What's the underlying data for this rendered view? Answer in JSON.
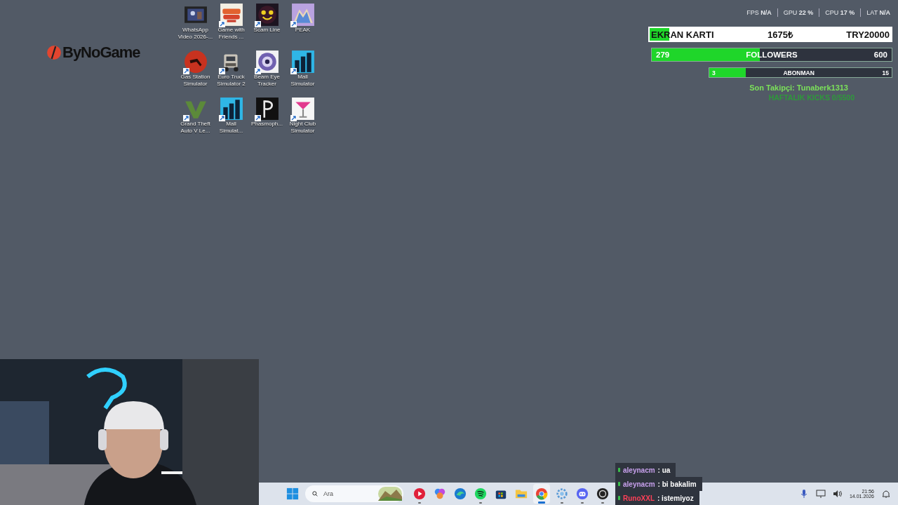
{
  "logo": {
    "text": "ByNoGame"
  },
  "desktop_icons": [
    {
      "kind": "video",
      "label": "WhatsApp Video 2026-...",
      "shortcut": false
    },
    {
      "kind": "game",
      "label": "Game with Friends ...",
      "shortcut": true
    },
    {
      "kind": "scam",
      "label": "Scam Line",
      "shortcut": true
    },
    {
      "kind": "peak",
      "label": "PEAK",
      "shortcut": true
    },
    {
      "kind": "gas",
      "label": "Gas Station Simulator",
      "shortcut": true
    },
    {
      "kind": "truck",
      "label": "Euro Truck Simulator 2",
      "shortcut": true
    },
    {
      "kind": "beam",
      "label": "Beam Eye Tracker",
      "shortcut": true
    },
    {
      "kind": "mall",
      "label": "Mall Simulator",
      "shortcut": true
    },
    {
      "kind": "gta",
      "label": "Grand Theft Auto V Le...",
      "shortcut": true
    },
    {
      "kind": "mall",
      "label": "Mall Simulat...",
      "shortcut": true
    },
    {
      "kind": "phasmo",
      "label": "Phasmoph...",
      "shortcut": true
    },
    {
      "kind": "club",
      "label": "Night Club Simulator",
      "shortcut": true
    }
  ],
  "stats": [
    {
      "label": "FPS",
      "value": "N/A"
    },
    {
      "label": "GPU",
      "value": "22 %"
    },
    {
      "label": "CPU",
      "value": "17 %"
    },
    {
      "label": "LAT",
      "value": "N/A"
    }
  ],
  "goals": [
    {
      "kind": "card",
      "title": "EKRAN KARTI",
      "current": "1675₺",
      "target": "TRY20000",
      "level": 0.08
    },
    {
      "kind": "followers",
      "title": "FOLLOWERS",
      "current": "279",
      "target": "600",
      "level": 0.45
    },
    {
      "kind": "subs",
      "title": "ABONMAN",
      "current": "3",
      "target": "15",
      "level": 0.2
    }
  ],
  "last_follower": "Son Takipçi: Tunaberk1313",
  "weekly_goal": "HAFTALIK KICKS 0/5500",
  "chat": [
    {
      "user": "aleynacm",
      "message": ": ua",
      "color": "#c7a0ec"
    },
    {
      "user": "aleynacm",
      "message": ": bi bakalim",
      "color": "#c7a0ec"
    },
    {
      "user": "RunoXXL",
      "message": ": istemiyoz",
      "color": "#ff4058"
    }
  ],
  "taskbar": {
    "search_placeholder": "Ara",
    "apps": [
      {
        "kind": "music",
        "running": true,
        "selected": false
      },
      {
        "kind": "copilot",
        "running": false,
        "selected": false
      },
      {
        "kind": "edge",
        "running": false,
        "selected": false
      },
      {
        "kind": "spotify",
        "running": true,
        "selected": false
      },
      {
        "kind": "store",
        "running": false,
        "selected": false
      },
      {
        "kind": "folder",
        "running": false,
        "selected": false
      },
      {
        "kind": "chrome",
        "running": true,
        "selected": true
      },
      {
        "kind": "gearapp",
        "running": true,
        "selected": false
      },
      {
        "kind": "discord",
        "running": true,
        "selected": false
      },
      {
        "kind": "obs",
        "running": true,
        "selected": false
      }
    ],
    "clock": {
      "time": "21:56",
      "date": "14.01.2026"
    }
  }
}
